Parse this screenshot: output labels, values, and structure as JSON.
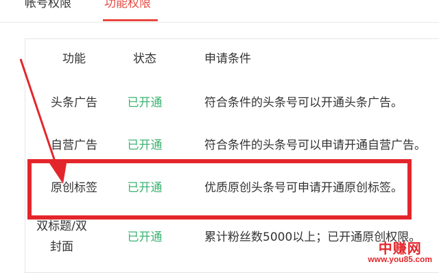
{
  "tabs": [
    {
      "label": "帐号权限",
      "active": false
    },
    {
      "label": "功能权限",
      "active": true
    }
  ],
  "accent_color": "#e8483f",
  "table": {
    "headers": [
      "功能",
      "状态",
      "申请条件"
    ],
    "rows": [
      {
        "feature": "头条广告",
        "status": "已开通",
        "condition": "符合条件的头条号可以开通头条广告。"
      },
      {
        "feature": "自营广告",
        "status": "已开通",
        "condition": "符合条件的头条号可以申请开通自营广告。"
      },
      {
        "feature": "原创标签",
        "status": "已开通",
        "condition": "优质原创头条号可申请开通原创标签。"
      },
      {
        "feature": "双标题/双封面",
        "status": "已开通",
        "condition": "累计粉丝数5000以上；已开通原创权限。"
      }
    ]
  },
  "status_color": "#3cb371",
  "highlight_color": "#e3262b",
  "watermark": {
    "title": "中赚网",
    "url": "www.you85.com"
  }
}
